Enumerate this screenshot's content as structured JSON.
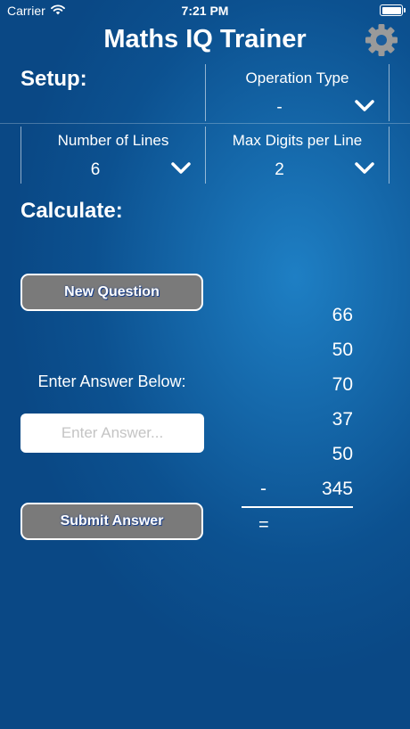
{
  "status_bar": {
    "carrier": "Carrier",
    "time": "7:21 PM",
    "wifi_icon": "wifi-icon",
    "battery_icon": "battery-icon"
  },
  "header": {
    "title": "Maths IQ Trainer",
    "settings_icon": "gear-icon"
  },
  "setup": {
    "heading": "Setup:",
    "operation_type": {
      "label": "Operation Type",
      "value": "-"
    },
    "number_of_lines": {
      "label": "Number of Lines",
      "value": "6"
    },
    "max_digits": {
      "label": "Max Digits per Line",
      "value": "2"
    }
  },
  "calculate": {
    "heading": "Calculate:",
    "new_question_label": "New Question",
    "answer_prompt": "Enter Answer Below:",
    "answer_placeholder": "Enter Answer...",
    "answer_value": "",
    "submit_label": "Submit Answer"
  },
  "problem": {
    "lines": [
      "66",
      "50",
      "70",
      "37",
      "50",
      "345"
    ],
    "operator": "-",
    "equals": "="
  },
  "colors": {
    "background": "#0c5190",
    "button_fill": "#7a7a7a",
    "text": "#ffffff"
  }
}
